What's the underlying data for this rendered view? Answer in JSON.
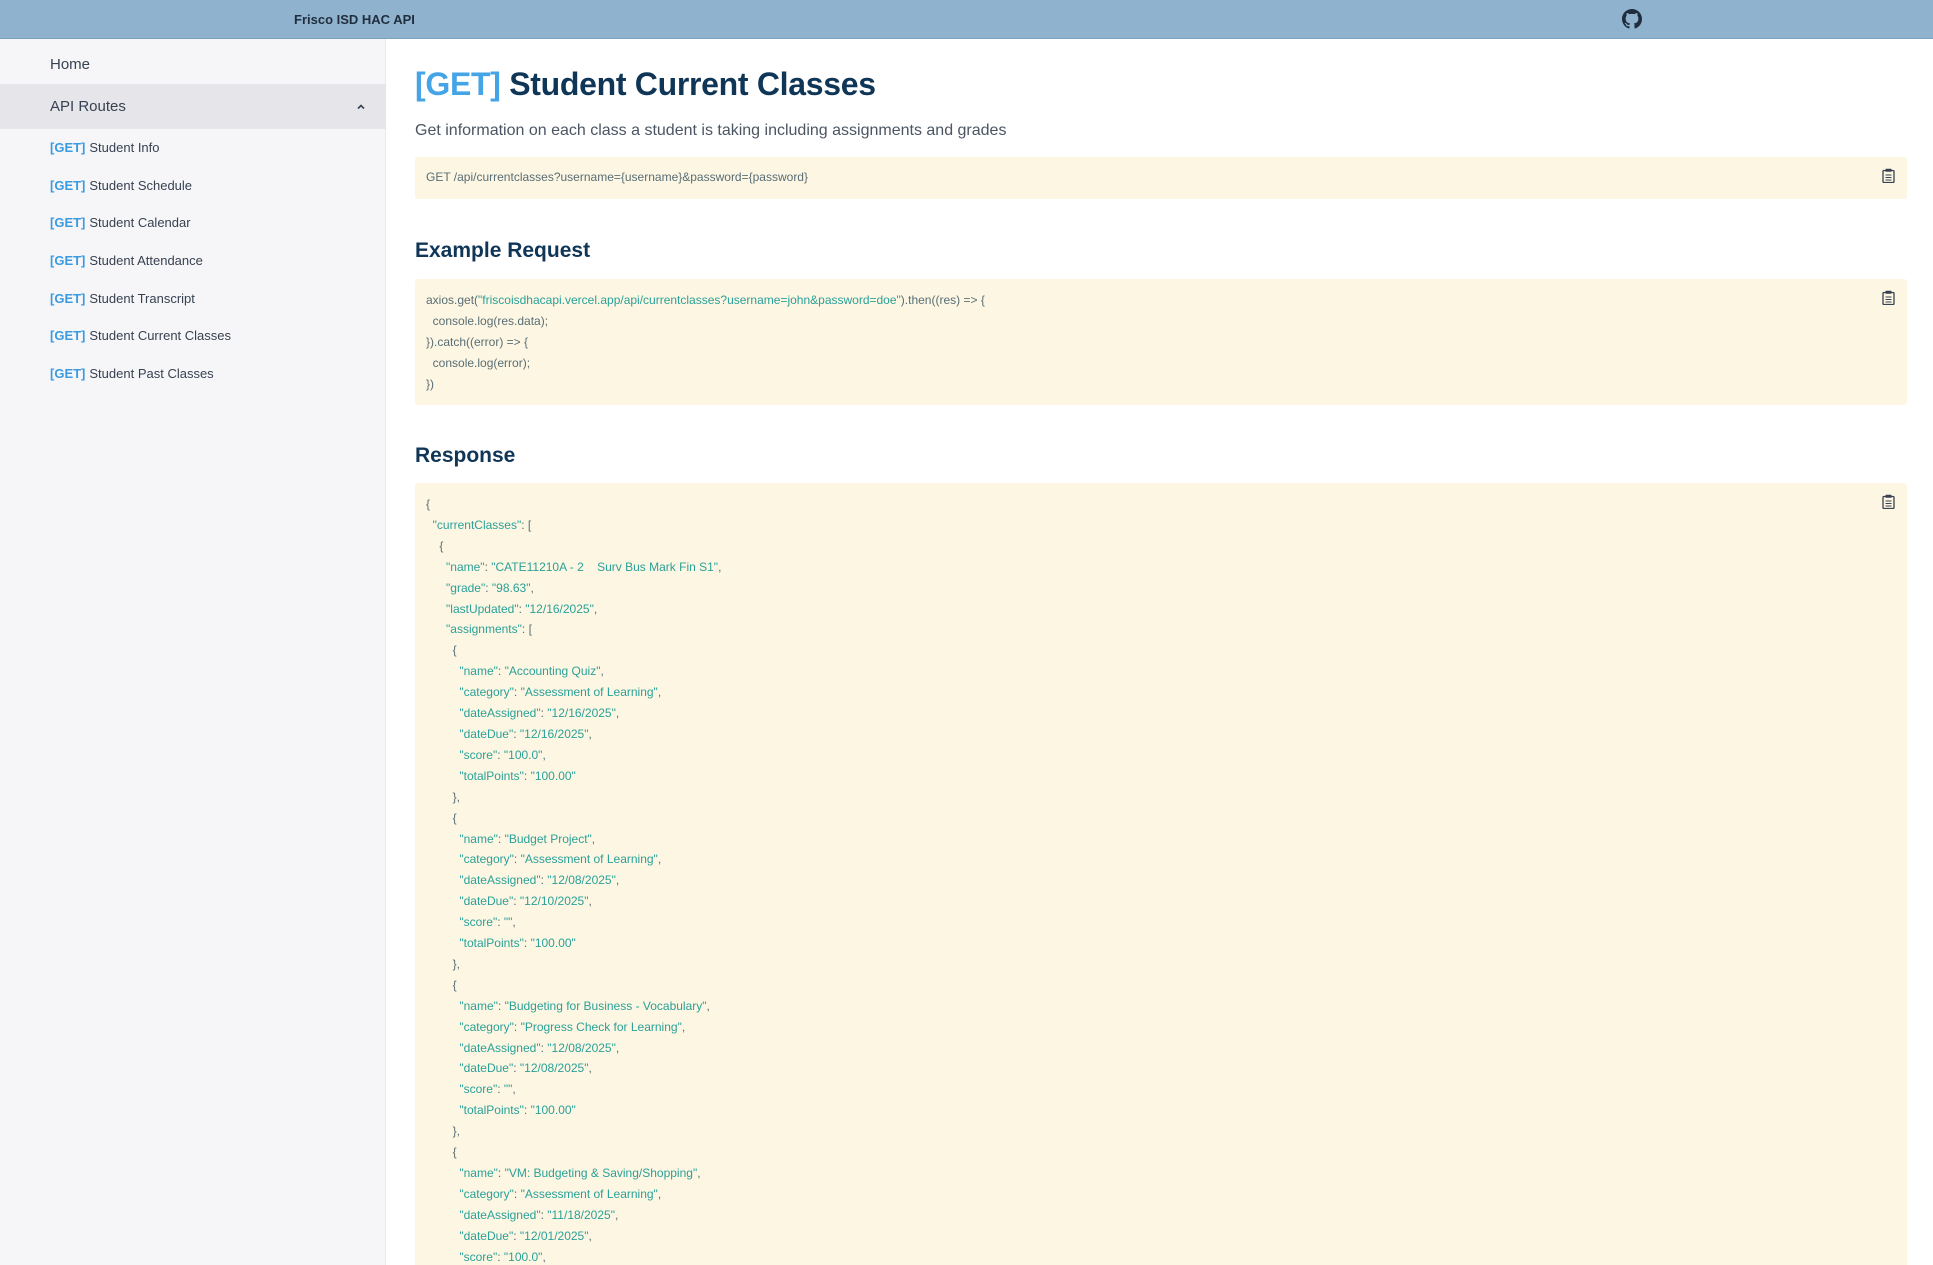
{
  "header": {
    "brand": "Frisco ISD HAC API",
    "github_icon": "github-icon"
  },
  "sidebar": {
    "home": "Home",
    "api_routes": "API Routes",
    "method": "[GET]",
    "items": [
      {
        "label": "Student Info"
      },
      {
        "label": "Student Schedule"
      },
      {
        "label": "Student Calendar"
      },
      {
        "label": "Student Attendance"
      },
      {
        "label": "Student Transcript"
      },
      {
        "label": "Student Current Classes"
      },
      {
        "label": "Student Past Classes"
      }
    ]
  },
  "page": {
    "method": "[GET]",
    "title": "Student Current Classes",
    "description": "Get information on each class a student is taking including assignments and grades",
    "endpoint": "GET /api/currentclasses?username={username}&password={password}",
    "example_heading": "Example Request",
    "response_heading": "Response"
  },
  "example": {
    "prefix": "axios.get(",
    "url": "\"friscoisdhacapi.vercel.app/api/currentclasses?username=john&password=doe\"",
    "suffix": ").then((res) => {",
    "lines": [
      "  console.log(res.data);",
      "}).catch((error) => {",
      "  console.log(error);",
      "})"
    ]
  },
  "response": {
    "class_name": "\"CATE11210A - 2    Surv Bus Mark Fin S1\"",
    "grade": "\"98.63\"",
    "last_updated": "\"12/16/2025\"",
    "assignments": [
      {
        "name": "\"Accounting Quiz\"",
        "category": "\"Assessment of Learning\"",
        "dateAssigned": "\"12/16/2025\"",
        "dateDue": "\"12/16/2025\"",
        "score": "\"100.0\"",
        "totalPoints": "\"100.00\""
      },
      {
        "name": "\"Budget Project\"",
        "category": "\"Assessment of Learning\"",
        "dateAssigned": "\"12/08/2025\"",
        "dateDue": "\"12/10/2025\"",
        "score": "\"\"",
        "totalPoints": "\"100.00\""
      },
      {
        "name": "\"Budgeting for Business - Vocabulary\"",
        "category": "\"Progress Check for Learning\"",
        "dateAssigned": "\"12/08/2025\"",
        "dateDue": "\"12/08/2025\"",
        "score": "\"\"",
        "totalPoints": "\"100.00\""
      },
      {
        "name": "\"VM: Budgeting & Saving/Shopping\"",
        "category": "\"Assessment of Learning\"",
        "dateAssigned": "\"11/18/2025\"",
        "dateDue": "\"12/01/2025\"",
        "score": "\"100.0\""
      }
    ]
  },
  "icons": {
    "copy": "clipboard-icon",
    "chevron": "chevron-up-icon"
  },
  "colors": {
    "header": "#8fb3cf",
    "method": "#45a4e6",
    "heading": "#0f3557",
    "code_bg": "#fdf6e3",
    "code_string": "#2aa198"
  }
}
